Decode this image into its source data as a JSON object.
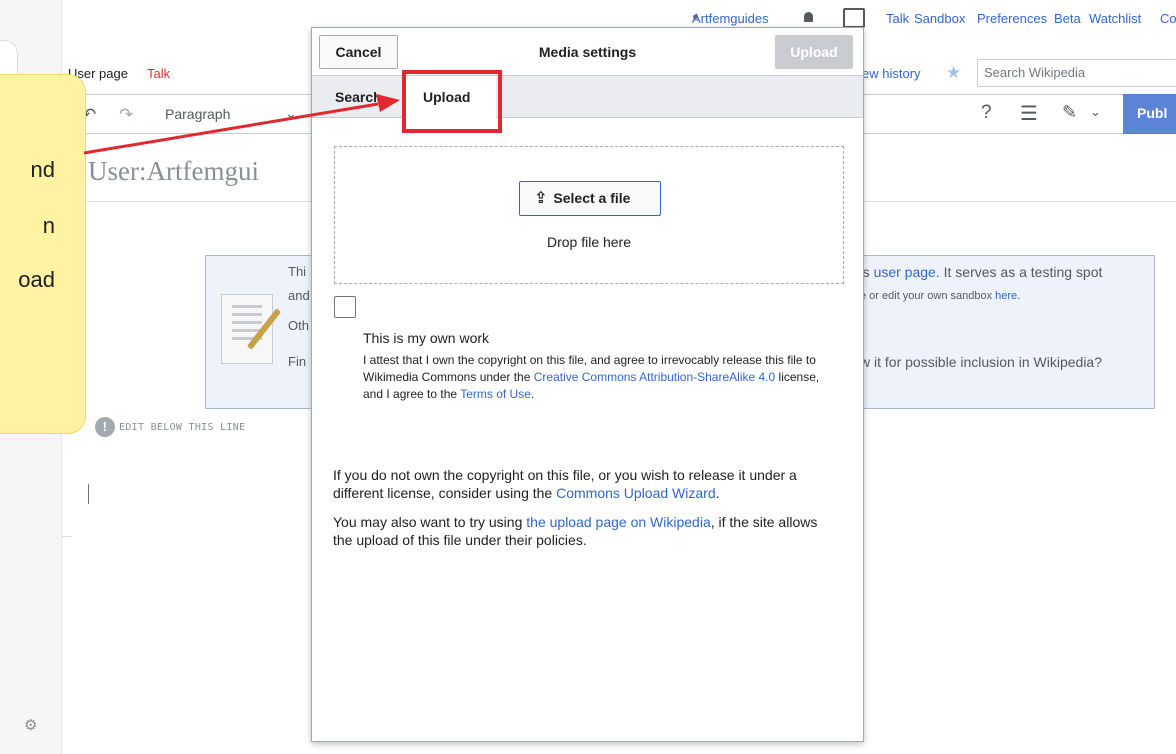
{
  "personal": {
    "username": "Artfemguides",
    "talk": "Talk",
    "sandbox": "Sandbox",
    "preferences": "Preferences",
    "beta": "Beta",
    "watchlist": "Watchlist",
    "contributions": "Co"
  },
  "tabs": {
    "user_page": "User page",
    "talk": "Talk",
    "view_history": "ew history",
    "search_placeholder": "Search Wikipedia"
  },
  "toolbar": {
    "paragraph": "Paragraph",
    "help": "?",
    "publish": "Publ"
  },
  "page": {
    "title": "User:Artfemgui",
    "notice_left": [
      "Thi",
      "and",
      "Oth",
      "Fin"
    ],
    "notice_right_line1_prefix": "'s ",
    "notice_right_line1_link": "user page",
    "notice_right_line1_suffix": ". It serves as a testing spot",
    "notice_right_line2_text": "e or edit your own sandbox ",
    "notice_right_line2_link": "here",
    "notice_right_line2_end": ".",
    "notice_right_line3": "w it for possible inclusion in Wikipedia?",
    "edit_below": "EDIT BELOW THIS LINE"
  },
  "callout": {
    "lines": [
      "nd",
      "n",
      "oad"
    ]
  },
  "dialog": {
    "title": "Media settings",
    "cancel": "Cancel",
    "upload_button": "Upload",
    "tab_search": "Search",
    "tab_upload": "Upload",
    "select_file": "Select a file",
    "drop_text": "Drop file here",
    "own_work_label": "This is my own work",
    "attest_text_1": "I attest that I own the copyright on this file, and agree to irrevocably release this file to Wikimedia Commons under the ",
    "attest_link_cc": "Creative Commons Attribution-ShareAlike 4.0",
    "attest_text_2": " license, and I agree to the ",
    "attest_link_terms": "Terms of Use",
    "attest_text_3": ".",
    "para1_text": "If you do not own the copyright on this file, or you wish to release it under a different license, consider using the ",
    "para1_link": "Commons Upload Wizard",
    "para1_end": ".",
    "para2_text_1": "You may also want to try using ",
    "para2_link": "the upload page on Wikipedia",
    "para2_text_2": ", if the site allows the upload of this file under their policies."
  },
  "colors": {
    "link": "#3366cc",
    "annotation_red": "#e0282e",
    "callout_yellow": "#fff3a3"
  }
}
